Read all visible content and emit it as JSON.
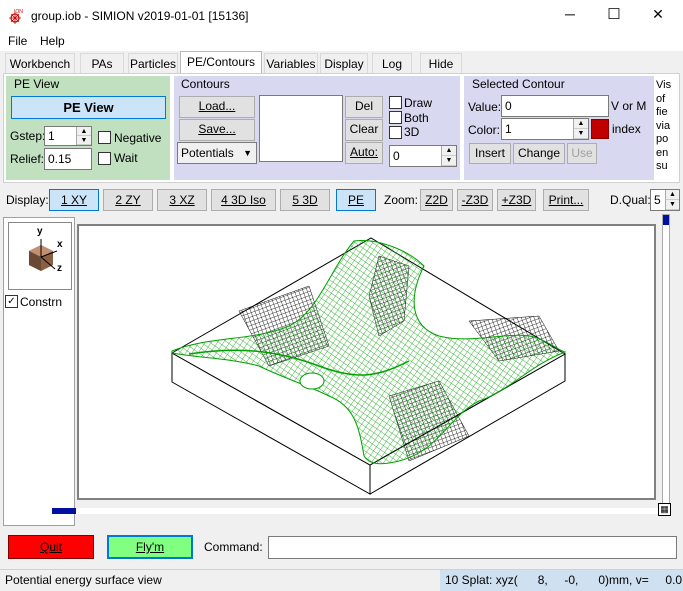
{
  "window": {
    "title": "group.iob - SIMION v2019-01-01 [15136]",
    "minimize": "─",
    "maximize": "☐",
    "close": "✕"
  },
  "menu": {
    "file": "File",
    "help": "Help"
  },
  "tabs": [
    "Workbench",
    "PAs",
    "Particles",
    "PE/Contours",
    "Variables",
    "Display",
    "Log",
    "Hide"
  ],
  "pe_view": {
    "heading": "PE View",
    "button": "PE View",
    "gstep_label": "Gstep:",
    "gstep_value": "1",
    "relief_label": "Relief:",
    "relief_value": "0.15",
    "negative": "Negative",
    "wait": "Wait"
  },
  "contours": {
    "heading": "Contours",
    "load": "Load...",
    "save": "Save...",
    "dropdown": "Potentials",
    "del": "Del",
    "clear": "Clear",
    "auto": "Auto:",
    "draw": "Draw",
    "both": "Both",
    "three_d": "3D",
    "auto_value": "0"
  },
  "selected_contour": {
    "heading": "Selected Contour",
    "value_label": "Value:",
    "value": "0",
    "units": "V or M",
    "color_label": "Color:",
    "color_value": "1",
    "color_units": "index",
    "swatch": "#c00000",
    "insert": "Insert",
    "change": "Change",
    "use": "Use"
  },
  "side_text": [
    "Vis",
    "of",
    "fie",
    "via",
    "po",
    "en",
    "su"
  ],
  "toolbar": {
    "display_label": "Display:",
    "views": [
      "1 XY",
      "2 ZY",
      "3 XZ",
      "4 3D Iso",
      "5 3D"
    ],
    "pe": "PE",
    "zoom_label": "Zoom:",
    "zoom": [
      "Z2D",
      "-Z3D",
      "+Z3D"
    ],
    "print": "Print...",
    "dqual_label": "D.Qual:",
    "dqual_value": "5"
  },
  "left_panel": {
    "axis_y": "y",
    "axis_x": "x",
    "axis_z": "z",
    "constrain": "Constrn"
  },
  "bottom": {
    "quit": "Quit",
    "flym": "Fly'm",
    "command_label": "Command:",
    "command_value": ""
  },
  "status": {
    "left": "Potential energy surface view",
    "right": "10 Splat: xyz(      8,     -0,      0)mm, v=     0.0"
  },
  "colors": {
    "pe_panel": "#c0e0c0",
    "contour_panel": "#d8d8f0",
    "quit": "#ff0000",
    "flym": "#80ff80",
    "surface": "#00a000"
  }
}
